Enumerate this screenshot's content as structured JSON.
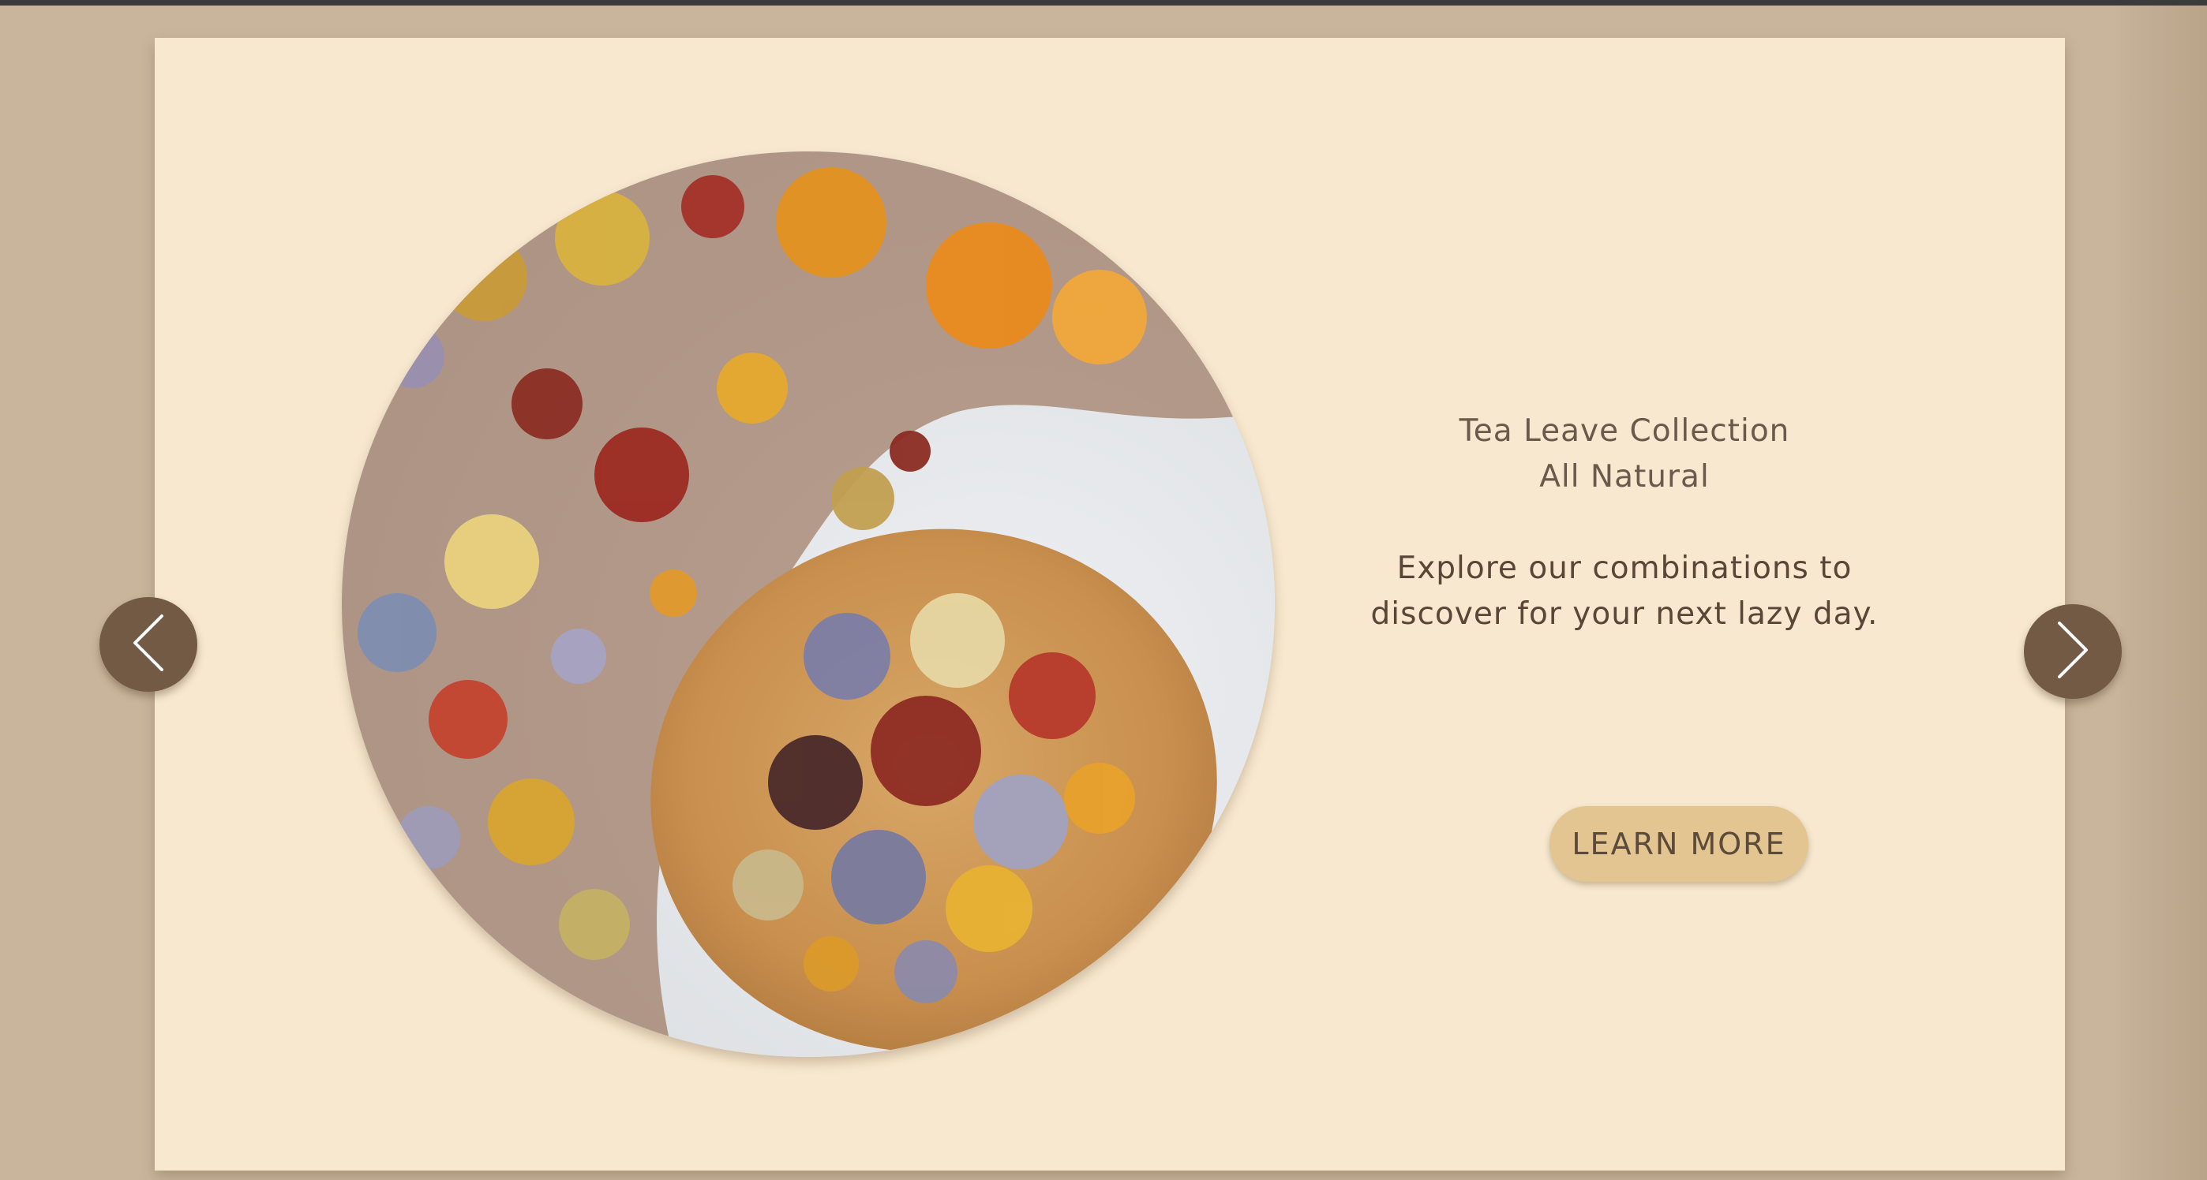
{
  "slide": {
    "image_alt": "Dried herbal tea blend with a wooden spoon",
    "title_line1": "Tea Leave Collection",
    "title_line2": "All Natural",
    "description_line1": "Explore our combinations to",
    "description_line2": "discover for your next lazy day.",
    "cta_label": "LEARN MORE"
  },
  "navigation": {
    "prev_icon": "chevron-left-icon",
    "next_icon": "chevron-right-icon"
  },
  "colors": {
    "page_bg": "#c9b59c",
    "card_bg": "#f7e8cf",
    "button_bg": "#e2c590",
    "arrow_bg": "#735a45",
    "text": "#5e4c3d"
  }
}
